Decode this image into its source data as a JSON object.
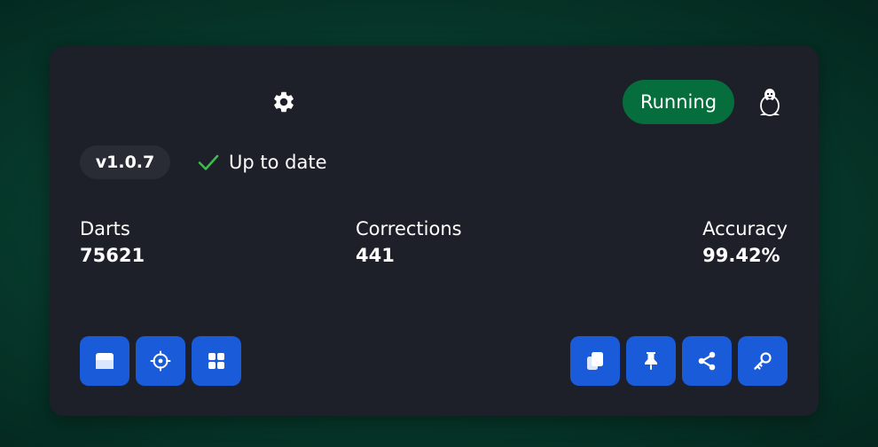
{
  "header": {
    "settings_icon": "gear-icon",
    "status": {
      "label": "Running",
      "color": "#066e3c"
    },
    "os_icon": "linux-penguin-icon"
  },
  "version": {
    "label": "v1.0.7",
    "update_status": "Up to date",
    "update_icon": "check-icon",
    "check_color": "#3dbb4c"
  },
  "stats": {
    "darts": {
      "label": "Darts",
      "value": "75621"
    },
    "corrections": {
      "label": "Corrections",
      "value": "441"
    },
    "accuracy": {
      "label": "Accuracy",
      "value": "99.42%"
    }
  },
  "toolbar": {
    "accent": "#1a5bd9",
    "left_buttons": [
      "window-icon",
      "crosshair-icon",
      "grid-icon"
    ],
    "right_buttons": [
      "copy-icon",
      "pin-icon",
      "share-icon",
      "key-icon"
    ]
  }
}
